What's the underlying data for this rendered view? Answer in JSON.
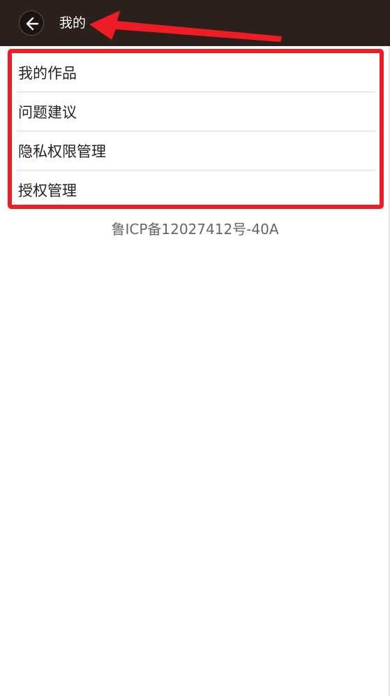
{
  "header": {
    "title": "我的",
    "back_icon": "back-arrow-icon",
    "background_color": "#2b201c"
  },
  "menu": {
    "items": [
      {
        "label": "我的作品"
      },
      {
        "label": "问题建议"
      },
      {
        "label": "隐私权限管理"
      },
      {
        "label": "授权管理"
      }
    ],
    "highlight_color": "#ee1c25"
  },
  "footer": {
    "icp": "鲁ICP备12027412号-40A"
  }
}
